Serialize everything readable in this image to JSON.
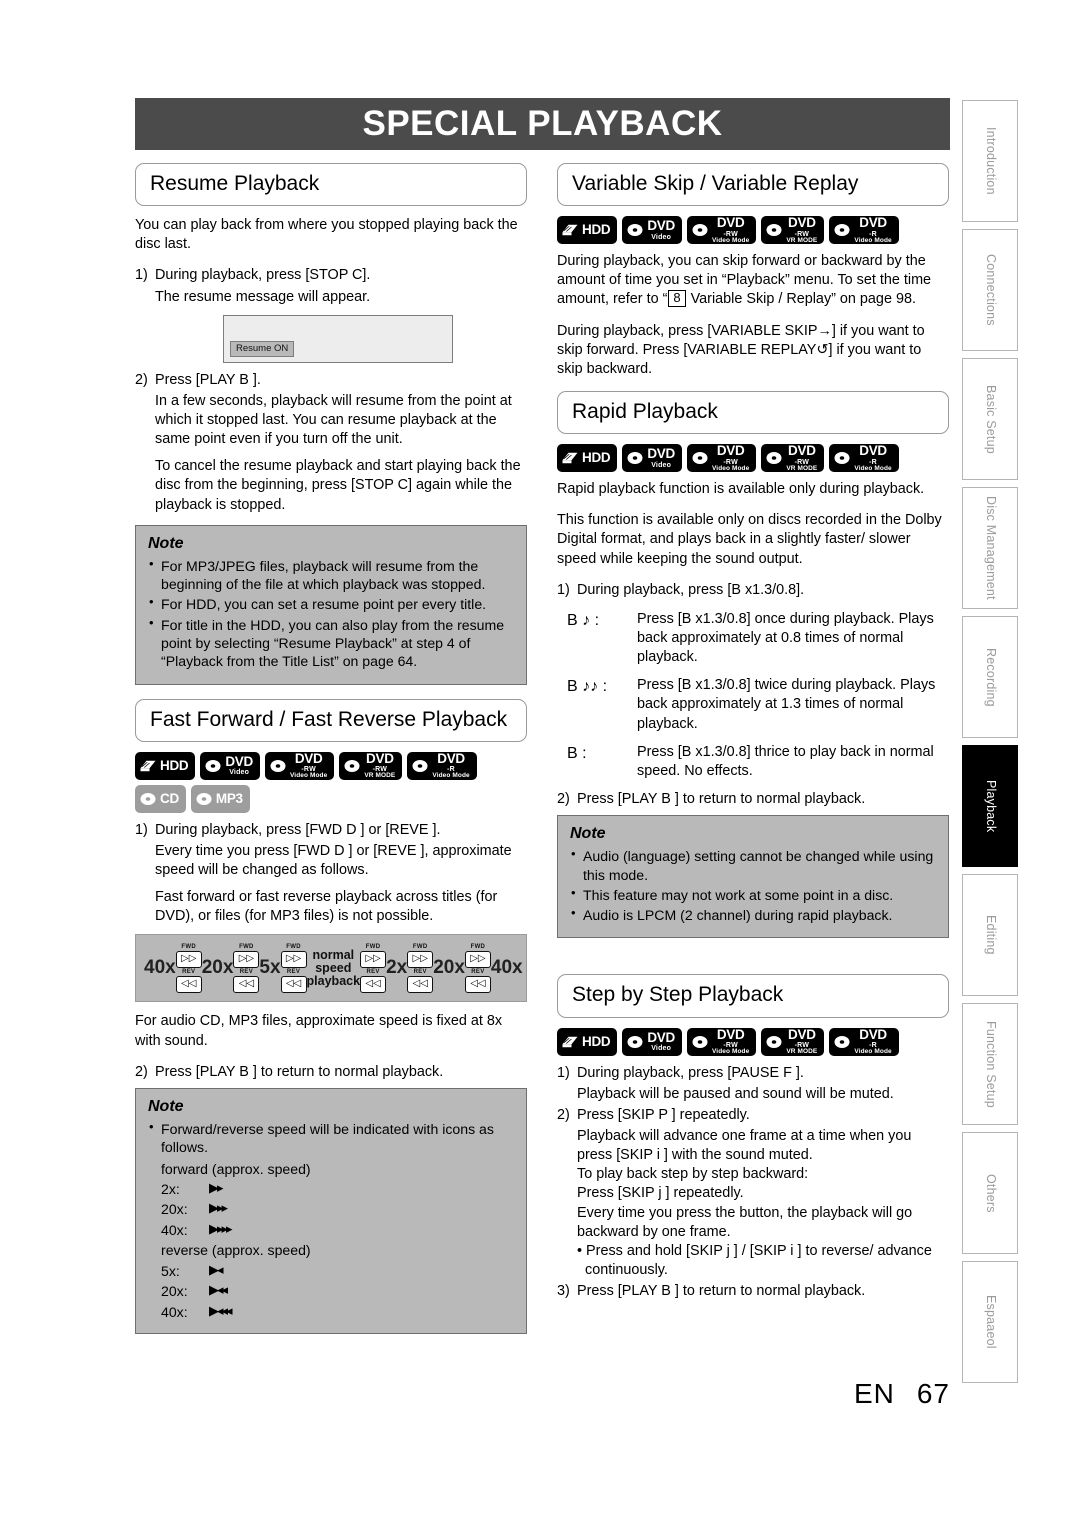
{
  "page": {
    "banner_title": "SPECIAL PLAYBACK",
    "footer_lang": "EN",
    "footer_page": "67"
  },
  "sidebar": {
    "tabs": [
      {
        "label": "Introduction",
        "active": false
      },
      {
        "label": "Connections",
        "active": false
      },
      {
        "label": "Basic Setup",
        "active": false
      },
      {
        "label": "Disc Management",
        "active": false
      },
      {
        "label": "Recording",
        "active": false
      },
      {
        "label": "Playback",
        "active": true
      },
      {
        "label": "Editing",
        "active": false
      },
      {
        "label": "Function Setup",
        "active": false
      },
      {
        "label": "Others",
        "active": false
      },
      {
        "label": "Espaaeol",
        "active": false
      }
    ]
  },
  "badges": {
    "hdd": {
      "main": "HDD",
      "sub": "",
      "sub2": "",
      "style": "black"
    },
    "dvd_video": {
      "main": "DVD",
      "sub": "Video",
      "sub2": "",
      "style": "black"
    },
    "dvd_rw_vid": {
      "main": "DVD",
      "sub": "-RW",
      "sub2": "Video Mode",
      "style": "black"
    },
    "dvd_rw_vr": {
      "main": "DVD",
      "sub": "-RW",
      "sub2": "VR MODE",
      "style": "black"
    },
    "dvd_r_vid": {
      "main": "DVD",
      "sub": "-R",
      "sub2": "Video Mode",
      "style": "black"
    },
    "cd": {
      "main": "CD",
      "sub": "",
      "sub2": "",
      "style": "gray"
    },
    "mp3": {
      "main": "MP3",
      "sub": "",
      "sub2": "",
      "style": "gray"
    }
  },
  "resume_playback": {
    "heading": "Resume Playback",
    "intro": "You can play back from where you stopped playing back the disc last.",
    "step1_num": "1)",
    "step1_text": "During playback, press [STOP C].",
    "step1_sub": "The resume message will appear.",
    "screen_button": "Resume ON",
    "step2_num": "2)",
    "step2_text": "Press [PLAY B ].",
    "step2_sub1": "In a few seconds, playback will resume from the point at which it stopped last. You can resume playback at the same point even if you turn off the unit.",
    "step2_sub2": "To cancel the resume playback and start playing back the disc from the beginning, press [STOP C] again while the playback is stopped.",
    "note_title": "Note",
    "notes": [
      "For MP3/JPEG files, playback will resume from the beginning of the file at which playback was stopped.",
      "For HDD, you can set a resume point per every title.",
      "For title in the HDD, you can also play from the resume point by selecting “Resume Playback” at step 4 of “Playback from the Title List” on page 64."
    ]
  },
  "fast_forward": {
    "heading": "Fast Forward / Fast Reverse Playback",
    "step1_num": "1)",
    "step1_text": "During playback, press [FWD D ] or [REVE ].",
    "step1_sub1": "Every time you press [FWD D ] or [REVE ], approximate speed will be changed as follows.",
    "step1_sub2": "Fast forward or fast reverse playback across titles (for DVD), or files (for MP3 files) is not possible.",
    "speed_diagram": {
      "labels": [
        "40x",
        "20x",
        "5x",
        "normal speed playback",
        "2x",
        "20x",
        "40x"
      ],
      "button_fwd_caption": "FWD",
      "button_rev_caption": "REV"
    },
    "after_diagram": "For audio CD, MP3 files, approximate speed is fixed at 8x with sound.",
    "step2_num": "2)",
    "step2_text": "Press [PLAY B ] to return to normal playback.",
    "note_title": "Note",
    "note_lead": "Forward/reverse speed will be indicated with icons as follows.",
    "forward_label": "forward (approx. speed)",
    "forward_rows": [
      {
        "x": "2x:",
        "icon": "▶▸"
      },
      {
        "x": "20x:",
        "icon": "▶▸▸"
      },
      {
        "x": "40x:",
        "icon": "▶▸▸▸"
      }
    ],
    "reverse_label": "reverse (approx. speed)",
    "reverse_rows": [
      {
        "x": "5x:",
        "icon": "▶◂"
      },
      {
        "x": "20x:",
        "icon": "▶◂◂"
      },
      {
        "x": "40x:",
        "icon": "▶◂◂◂"
      }
    ]
  },
  "variable_skip": {
    "heading": "Variable Skip / Variable Replay",
    "para1_a": "During playback, you can skip forward or backward by the amount of time you set in “Playback” menu. To set the time amount, refer to “",
    "para1_box": "8",
    "para1_b": " Variable Skip / Replay” on page 98.",
    "para2": "During playback, press [VARIABLE SKIP→] if you want to skip forward. Press [VARIABLE REPLAY↺] if you want to skip backward."
  },
  "rapid_playback": {
    "heading": "Rapid Playback",
    "para1": "Rapid playback function is available only during playback.",
    "para2": "This function is available only on discs recorded in the Dolby Digital format, and plays back in a slightly faster/ slower speed while keeping the sound output.",
    "step1_num": "1)",
    "step1_text": "During playback, press [B x1.3/0.8].",
    "rows": [
      {
        "key": "B ♪ :",
        "val": "Press [B x1.3/0.8] once during playback. Plays back approximately at 0.8 times of normal playback."
      },
      {
        "key": "B ♪♪ :",
        "val": "Press [B x1.3/0.8] twice during playback. Plays back approximately at 1.3 times of normal playback."
      },
      {
        "key": "B :",
        "val": "Press [B x1.3/0.8] thrice to play back in normal speed. No effects."
      }
    ],
    "step2_num": "2)",
    "step2_text": "Press [PLAY B ] to return to normal playback.",
    "note_title": "Note",
    "notes": [
      "Audio (language) setting cannot be changed while using this mode.",
      "This feature may not work at some point in a disc.",
      "Audio is LPCM (2 channel) during rapid playback."
    ]
  },
  "step_by_step": {
    "heading": "Step by Step Playback",
    "step1_num": "1)",
    "step1_text": "During playback, press [PAUSE F ].",
    "step1_sub": "Playback will be paused and sound will be muted.",
    "step2_num": "2)",
    "step2_text": "Press [SKIP P       ] repeatedly.",
    "step2_sub1": "Playback will advance one frame at a time when you press [SKIP i       ] with the sound muted.",
    "step2_sub2": "To play back step by step backward:",
    "step2_sub3": "Press [SKIP j       ] repeatedly.",
    "step2_sub4": "Every time you press the button, the playback will go backward by one frame.",
    "step2_bullet": "Press and hold [SKIP j       ] / [SKIP i       ] to reverse/ advance continuously.",
    "step3_num": "3)",
    "step3_text": "Press [PLAY B ] to return to normal playback."
  }
}
